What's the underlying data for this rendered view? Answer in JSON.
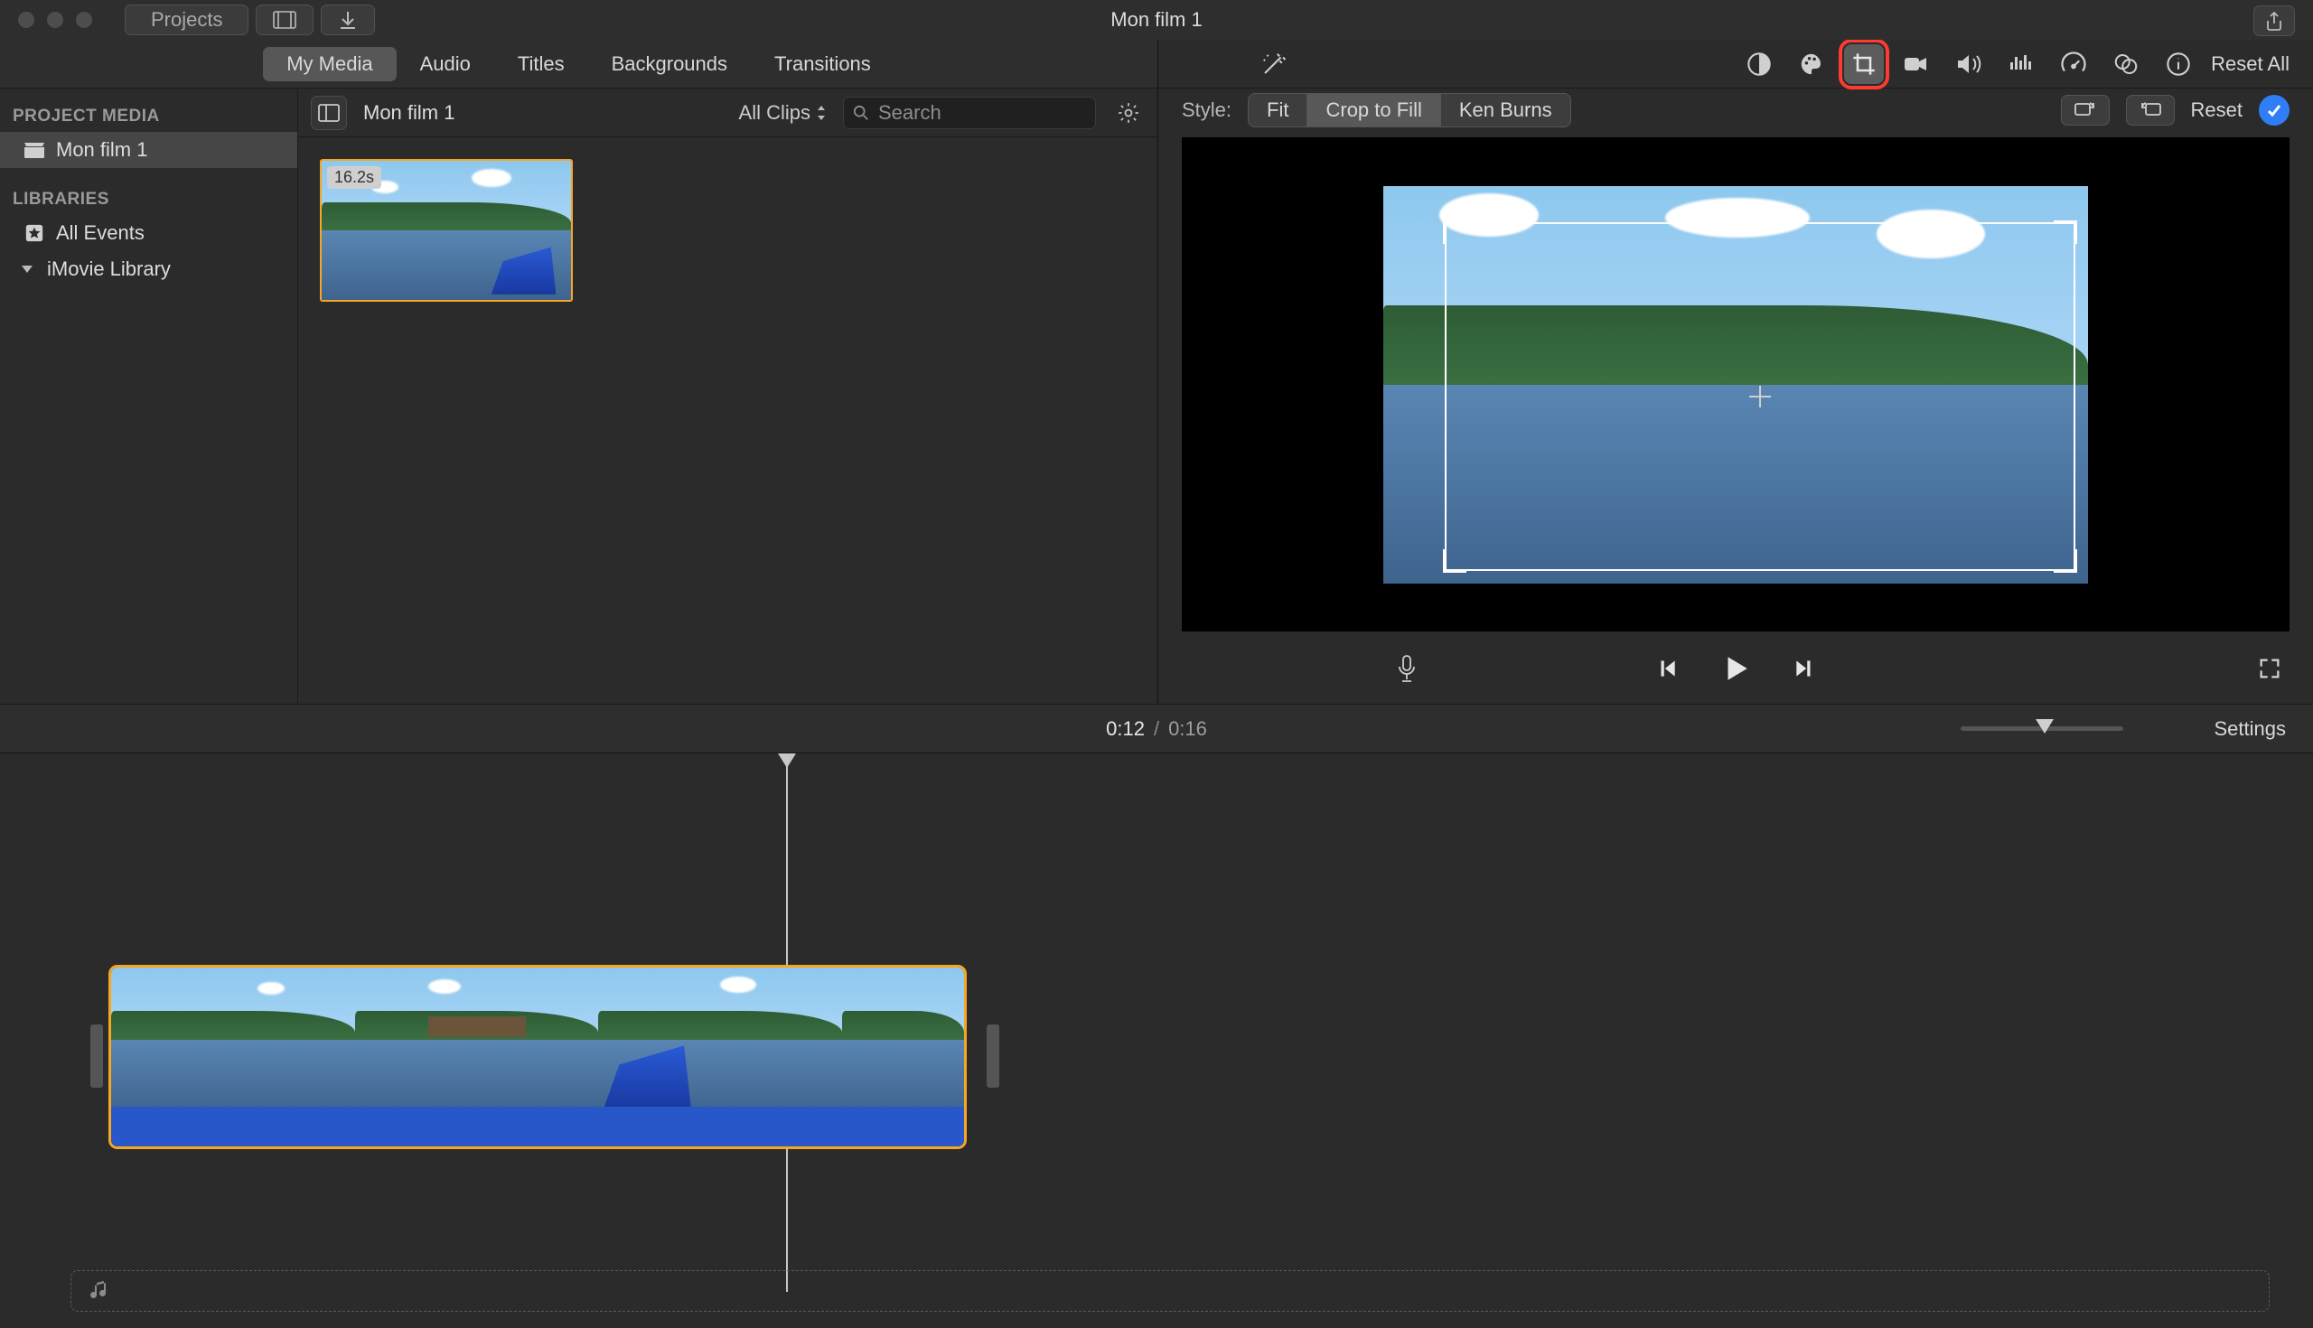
{
  "titlebar": {
    "projects": "Projects",
    "window_title": "Mon film 1"
  },
  "library_tabs": {
    "my_media": "My Media",
    "audio": "Audio",
    "titles": "Titles",
    "backgrounds": "Backgrounds",
    "transitions": "Transitions"
  },
  "sidebar": {
    "project_media_header": "PROJECT MEDIA",
    "project_item": "Mon film 1",
    "libraries_header": "LIBRARIES",
    "all_events": "All Events",
    "imovie_library": "iMovie Library"
  },
  "browser_bar": {
    "breadcrumb": "Mon film 1",
    "all_clips": "All Clips",
    "search_placeholder": "Search"
  },
  "clip": {
    "duration_badge": "16.2s"
  },
  "viewer": {
    "reset_all": "Reset All",
    "style_label": "Style:",
    "seg_fit": "Fit",
    "seg_crop_to_fill": "Crop to Fill",
    "seg_ken_burns": "Ken Burns",
    "reset": "Reset"
  },
  "timebar": {
    "current": "0:12",
    "slash": "/",
    "duration": "0:16",
    "settings": "Settings"
  }
}
